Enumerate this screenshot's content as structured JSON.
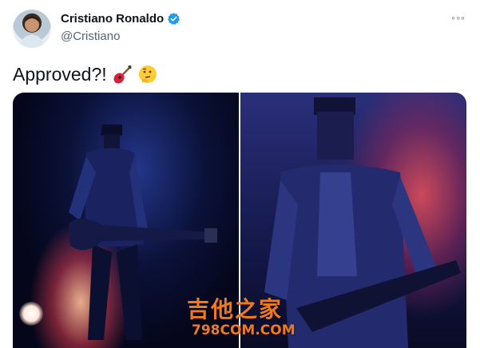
{
  "author": {
    "display_name": "Cristiano Ronaldo",
    "handle": "@Cristiano",
    "verified_color": "#1d9bf0"
  },
  "menu": {
    "more_icon": "◦◦◦"
  },
  "tweet": {
    "text": "Approved?!",
    "emojis": [
      "guitar-icon",
      "thinking-face-icon"
    ]
  },
  "media": {
    "photo_count": 2,
    "photos": [
      {
        "description_icon": "guitarist-photo-left"
      },
      {
        "description_icon": "guitarist-photo-right"
      }
    ]
  },
  "watermark": {
    "chinese": "吉他之家",
    "url": "798COM.COM"
  }
}
